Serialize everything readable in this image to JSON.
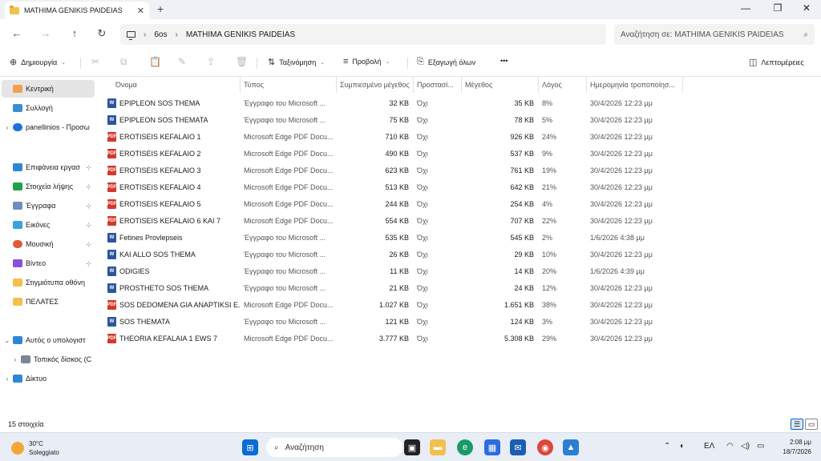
{
  "window": {
    "tab_title": "MATHIMA GENIKIS PAIDEIAS",
    "close_tab": "✕",
    "new_tab": "+",
    "minimize": "—",
    "maximize": "❐",
    "close": "✕"
  },
  "address": {
    "back": "←",
    "forward": "→",
    "up": "↑",
    "refresh": "↻",
    "breadcrumb": [
      "6os",
      "MATHIMA GENIKIS PAIDEIAS"
    ],
    "separator": "›",
    "search_placeholder": "Αναζήτηση σε: MATHIMA GENIKIS PAIDEIAS"
  },
  "toolbar": {
    "new_label": "Δημιουργία",
    "sort_label": "Ταξινόμηση",
    "view_label": "Προβολή",
    "extract_label": "Εξαγωγή όλων",
    "more_label": "•••",
    "details_label": "Λεπτομέρειες"
  },
  "sidebar": {
    "items": [
      {
        "label": "Κεντρική",
        "chev": ""
      },
      {
        "label": "Συλλογή",
        "chev": ""
      },
      {
        "label": "panellinios - Προσω",
        "chev": "›"
      },
      {
        "label": "Επιφάνεια εργασ",
        "chev": ""
      },
      {
        "label": "Στοιχεία λήψης",
        "chev": ""
      },
      {
        "label": "Έγγραφα",
        "chev": ""
      },
      {
        "label": "Εικόνες",
        "chev": ""
      },
      {
        "label": "Μουσική",
        "chev": ""
      },
      {
        "label": "Βίντεο",
        "chev": ""
      },
      {
        "label": "Στιγμιότυπα οθόνη",
        "chev": ""
      },
      {
        "label": "ΠΕΛΑΤΕΣ",
        "chev": ""
      },
      {
        "label": "Αυτός ο υπολογιστ",
        "chev": "⌄"
      },
      {
        "label": "Τοπικός δίσκος (C",
        "chev": "›"
      },
      {
        "label": "Δίκτυο",
        "chev": "›"
      }
    ],
    "pin": "📌"
  },
  "columns": {
    "name": "Όνομα",
    "type": "Τύπος",
    "compressed": "Συμπιεσμένο μέγεθος",
    "protected": "Προστασί...",
    "size": "Μέγεθος",
    "ratio": "Λόγος",
    "modified": "Ημερομηνία τροποποίησ...",
    "sort_caret": "^"
  },
  "files": [
    {
      "icon": "word",
      "icon_label": "W",
      "name": "EPIPLEON SOS THEMA",
      "type": "Έγγραφο του Microsoft ...",
      "compressed": "32 KB",
      "protected": "Όχι",
      "size": "35 KB",
      "ratio": "8%",
      "modified": "30/4/2026 12:23 μμ"
    },
    {
      "icon": "word",
      "icon_label": "W",
      "name": "EPIPLEON SOS THEMATA",
      "type": "Έγγραφο του Microsoft ...",
      "compressed": "75 KB",
      "protected": "Όχι",
      "size": "78 KB",
      "ratio": "5%",
      "modified": "30/4/2026 12:23 μμ"
    },
    {
      "icon": "pdf",
      "icon_label": "PDF",
      "name": "EROTISEIS KEFALAIO 1",
      "type": "Microsoft Edge PDF Docu...",
      "compressed": "710 KB",
      "protected": "Όχι",
      "size": "926 KB",
      "ratio": "24%",
      "modified": "30/4/2026 12:23 μμ"
    },
    {
      "icon": "pdf",
      "icon_label": "PDF",
      "name": "EROTISEIS KEFALAIO 2",
      "type": "Microsoft Edge PDF Docu...",
      "compressed": "490 KB",
      "protected": "Όχι",
      "size": "537 KB",
      "ratio": "9%",
      "modified": "30/4/2026 12:23 μμ"
    },
    {
      "icon": "pdf",
      "icon_label": "PDF",
      "name": "EROTISEIS KEFALAIO 3",
      "type": "Microsoft Edge PDF Docu...",
      "compressed": "623 KB",
      "protected": "Όχι",
      "size": "761 KB",
      "ratio": "19%",
      "modified": "30/4/2026 12:23 μμ"
    },
    {
      "icon": "pdf",
      "icon_label": "PDF",
      "name": "EROTISEIS KEFALAIO 4",
      "type": "Microsoft Edge PDF Docu...",
      "compressed": "513 KB",
      "protected": "Όχι",
      "size": "642 KB",
      "ratio": "21%",
      "modified": "30/4/2026 12:23 μμ"
    },
    {
      "icon": "pdf",
      "icon_label": "PDF",
      "name": "EROTISEIS KEFALAIO 5",
      "type": "Microsoft Edge PDF Docu...",
      "compressed": "244 KB",
      "protected": "Όχι",
      "size": "254 KB",
      "ratio": "4%",
      "modified": "30/4/2026 12:23 μμ"
    },
    {
      "icon": "pdf",
      "icon_label": "PDF",
      "name": "EROTISEIS KEFALAIO 6 KAI 7",
      "type": "Microsoft Edge PDF Docu...",
      "compressed": "554 KB",
      "protected": "Όχι",
      "size": "707 KB",
      "ratio": "22%",
      "modified": "30/4/2026 12:23 μμ"
    },
    {
      "icon": "word",
      "icon_label": "W",
      "name": "Fetines Provlepseis",
      "type": "Έγγραφο του Microsoft ...",
      "compressed": "535 KB",
      "protected": "Όχι",
      "size": "545 KB",
      "ratio": "2%",
      "modified": "1/6/2026 4:38 μμ"
    },
    {
      "icon": "word",
      "icon_label": "W",
      "name": "KAI ALLO SOS THEMA",
      "type": "Έγγραφο του Microsoft ...",
      "compressed": "26 KB",
      "protected": "Όχι",
      "size": "29 KB",
      "ratio": "10%",
      "modified": "30/4/2026 12:23 μμ"
    },
    {
      "icon": "word",
      "icon_label": "W",
      "name": "ODIGIES",
      "type": "Έγγραφο του Microsoft ...",
      "compressed": "11 KB",
      "protected": "Όχι",
      "size": "14 KB",
      "ratio": "20%",
      "modified": "1/6/2026 4:39 μμ"
    },
    {
      "icon": "word",
      "icon_label": "W",
      "name": "PROSTHETO SOS THEMA",
      "type": "Έγγραφο του Microsoft ...",
      "compressed": "21 KB",
      "protected": "Όχι",
      "size": "24 KB",
      "ratio": "12%",
      "modified": "30/4/2026 12:23 μμ"
    },
    {
      "icon": "pdf",
      "icon_label": "PDF",
      "name": "SOS DEDOMENA GIA ANAPTIKSI E...",
      "type": "Microsoft Edge PDF Docu...",
      "compressed": "1.027 KB",
      "protected": "Όχι",
      "size": "1.651 KB",
      "ratio": "38%",
      "modified": "30/4/2026 12:23 μμ"
    },
    {
      "icon": "word",
      "icon_label": "W",
      "name": "SOS THEMATA",
      "type": "Έγγραφο του Microsoft ...",
      "compressed": "121 KB",
      "protected": "Όχι",
      "size": "124 KB",
      "ratio": "3%",
      "modified": "30/4/2026 12:23 μμ"
    },
    {
      "icon": "pdf",
      "icon_label": "PDF",
      "name": "THEORIA KEFALAIA 1 EWS 7",
      "type": "Microsoft Edge PDF Docu...",
      "compressed": "3.777 KB",
      "protected": "Όχι",
      "size": "5.308 KB",
      "ratio": "29%",
      "modified": "30/4/2026 12:23 μμ"
    }
  ],
  "status": {
    "count": "15 στοιχεία"
  },
  "taskbar": {
    "temp": "30°C",
    "weather": "Soleggiato",
    "search": "Αναζήτηση",
    "lang": "ΕΛ",
    "time": "2:08 μμ",
    "date": "18/7/2026"
  },
  "colors": {
    "word": "#2b579a",
    "pdf": "#d7372b",
    "folder": "#f2c04c",
    "accent": "#0067c0"
  }
}
